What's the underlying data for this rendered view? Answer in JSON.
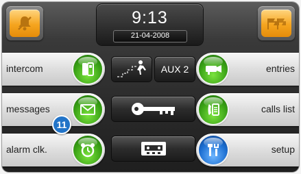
{
  "clock": {
    "time": "9:13",
    "date": "21-04-2008"
  },
  "left_buttons": [
    {
      "label": "intercom",
      "icon": "intercom-handset-icon"
    },
    {
      "label": "messages",
      "icon": "envelope-icon"
    },
    {
      "label": "alarm clk.",
      "icon": "alarm-clock-icon"
    }
  ],
  "right_buttons": [
    {
      "label": "entries",
      "icon": "camera-icon"
    },
    {
      "label": "calls list",
      "icon": "phone-list-icon"
    },
    {
      "label": "setup",
      "icon": "tools-icon"
    }
  ],
  "center_buttons": {
    "stairs_icon": "stairs-light-icon",
    "aux2_label": "AUX 2",
    "key_icon": "key-icon",
    "cassette_icon": "cassette-icon"
  },
  "top_buttons": {
    "left_icon": "bell-muted-icon",
    "right_icon": "flags-icon"
  },
  "badge": {
    "number": "11"
  },
  "colors": {
    "accent_orange": "#f5a51f",
    "green": "#3aa216",
    "blue": "#1c6ed1"
  }
}
